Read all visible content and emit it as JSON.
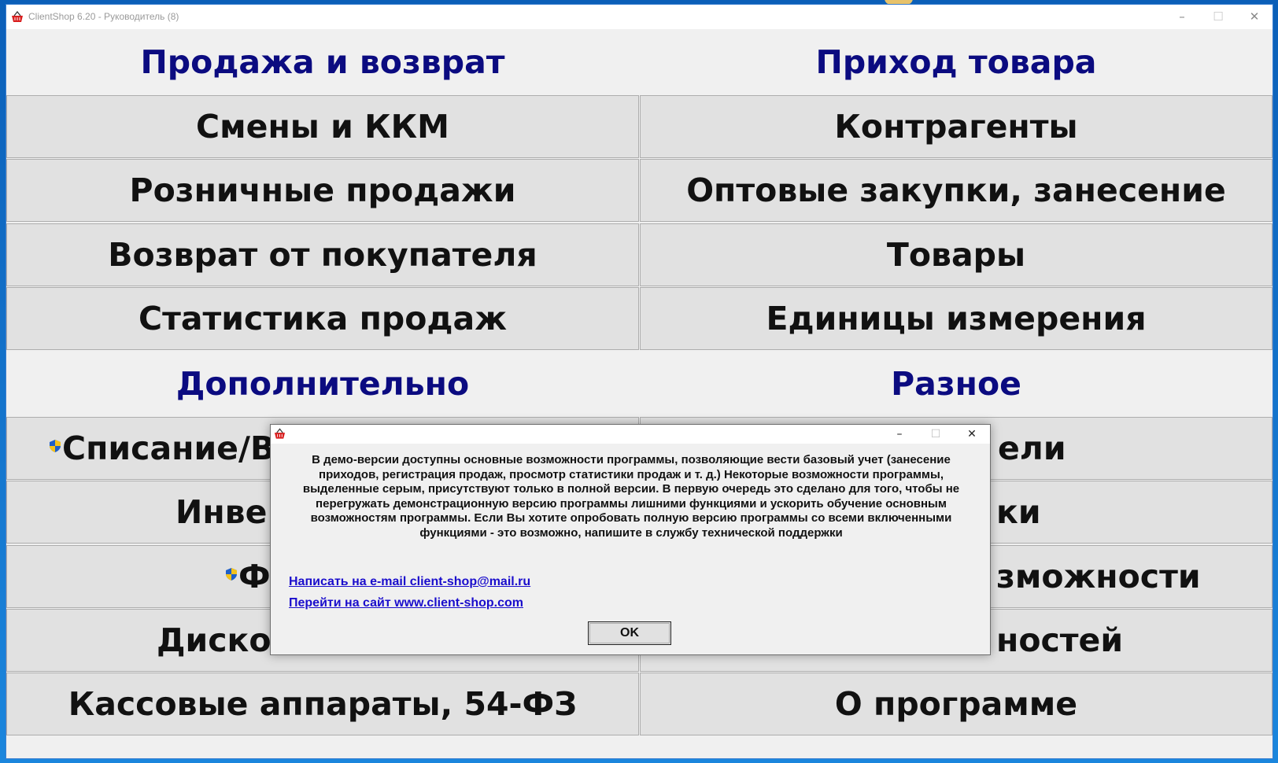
{
  "window": {
    "title": "ClientShop 6.20 - Руководитель (8)"
  },
  "left_column": {
    "header": "Продажа и возврат",
    "buttons": [
      "Смены и ККМ",
      "Розничные продажи",
      "Возврат от покупателя",
      "Статистика продаж"
    ],
    "header2": "Дополнительно",
    "buttons2": [
      "Списание/Во",
      "Инве",
      "Ф",
      "Дискон",
      "Кассовые аппараты, 54-ФЗ"
    ]
  },
  "right_column": {
    "header": "Приход товара",
    "buttons": [
      "Контрагенты",
      "Оптовые закупки, занесение",
      "Товары",
      "Единицы измерения"
    ],
    "header2": "Разное",
    "buttons2": [
      "ели",
      "ки",
      "зможности",
      "ностей",
      "О программе"
    ]
  },
  "dialog": {
    "message": "В демо-версии доступны основные возможности программы, позволяющие вести базовый учет (занесение приходов, регистрация продаж, просмотр статистики продаж и т. д.) Некоторые возможности программы, выделенные серым, присутствуют только в полной версии. В первую очередь это сделано для того, чтобы не перегружать демонстрационную версию программы лишними функциями и ускорить обучение основным возможностям программы. Если Вы хотите опробовать полную версию программы со всеми включенными функциями - это возможно, напишите в службу технической поддержки",
    "email_link": "Написать на e-mail client-shop@mail.ru",
    "site_link": "Перейти на сайт www.client-shop.com",
    "ok_label": "OK"
  },
  "icons": {
    "app": "basket-icon",
    "shield": "uac-shield-icon"
  },
  "colors": {
    "header_text": "#0b0b80",
    "link": "#1a0dcc",
    "button_face": "#e1e1e1"
  }
}
